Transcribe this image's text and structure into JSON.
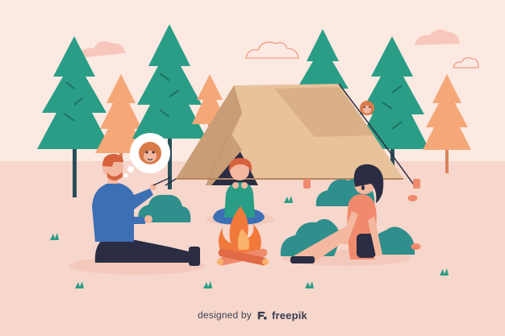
{
  "scene": {
    "subject": "camping",
    "colors": {
      "background": "#fbe9e2",
      "ground": "#f7d7cc",
      "cloud": "#f7c7bc",
      "tree_green": "#2a9d86",
      "tree_orange": "#f5a777",
      "tent_light": "#e8c29b",
      "tent_dark": "#c99d75",
      "bush": "#2f8f8c",
      "fire": "#f1793b",
      "skin": "#f4b8a0",
      "hair_red": "#d8623e",
      "hair_dark": "#2a2d43",
      "shirt_blue": "#3d6fb5",
      "shirt_green": "#2a9d86",
      "shirt_coral": "#f08a6d",
      "pants_dark": "#2a2d43"
    },
    "icons": [
      "tree-icon",
      "tent-icon",
      "campfire-icon",
      "bush-icon",
      "cloud-icon",
      "bigfoot-thought-bubble-icon",
      "grass-tuft-icon"
    ]
  },
  "credit": {
    "text": "designed by",
    "brand": "freepik",
    "brand_icon": "freepik-logo-icon"
  }
}
